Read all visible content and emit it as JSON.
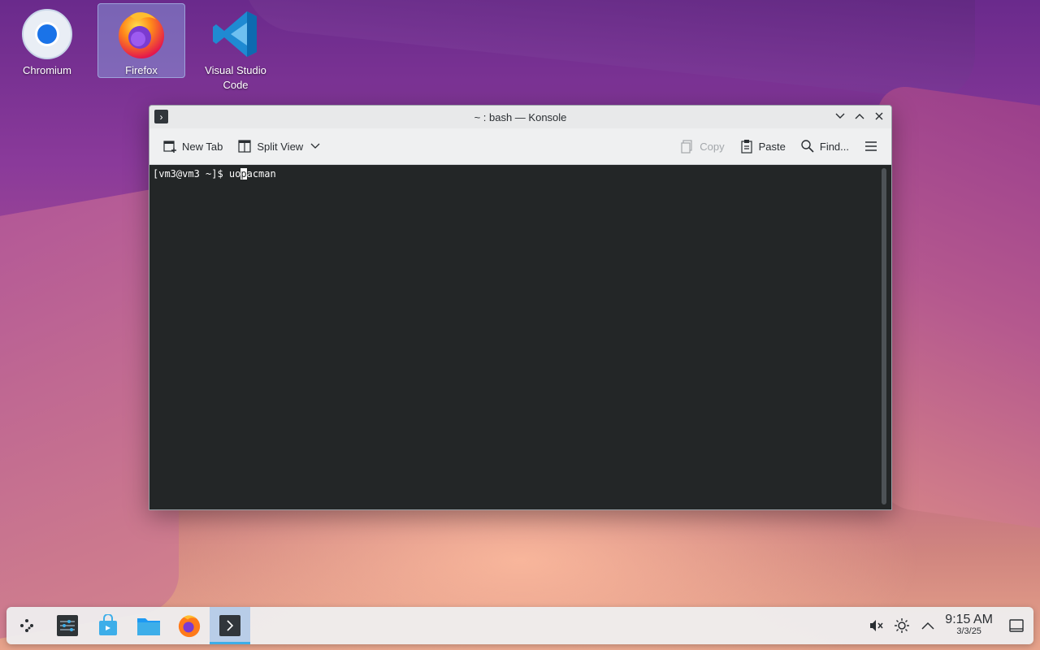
{
  "desktop": {
    "icons": [
      {
        "label": "Chromium"
      },
      {
        "label": "Firefox"
      },
      {
        "label": "Visual Studio Code"
      }
    ]
  },
  "window": {
    "title": "~ : bash — Konsole",
    "toolbar": {
      "new_tab": "New Tab",
      "split_view": "Split View",
      "copy": "Copy",
      "paste": "Paste",
      "find": "Find..."
    },
    "terminal": {
      "prompt": "[vm3@vm3 ~]$ ",
      "text_before_cursor": "uo",
      "cursor_char": "p",
      "text_after_cursor": "acman"
    }
  },
  "taskbar": {
    "clock": {
      "time": "9:15 AM",
      "date": "3/3/25"
    }
  },
  "colors": {
    "terminal_bg": "#232627",
    "accent": "#3daee9"
  }
}
